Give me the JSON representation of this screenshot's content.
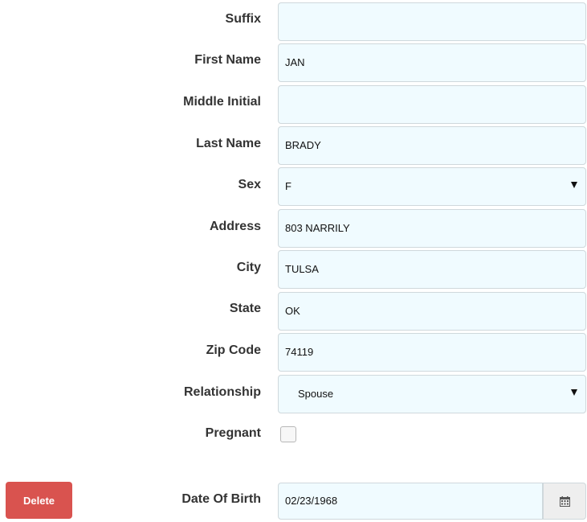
{
  "form": {
    "suffix": {
      "label": "Suffix",
      "value": ""
    },
    "first_name": {
      "label": "First Name",
      "value": "JAN"
    },
    "middle_initial": {
      "label": "Middle Initial",
      "value": ""
    },
    "last_name": {
      "label": "Last Name",
      "value": "BRADY"
    },
    "sex": {
      "label": "Sex",
      "value": "F"
    },
    "address": {
      "label": "Address",
      "value": "803 NARRILY"
    },
    "city": {
      "label": "City",
      "value": "TULSA"
    },
    "state": {
      "label": "State",
      "value": "OK"
    },
    "zip_code": {
      "label": "Zip Code",
      "value": "74119"
    },
    "relationship": {
      "label": "Relationship",
      "value": "Spouse"
    },
    "pregnant": {
      "label": "Pregnant",
      "checked": false
    },
    "date_of_birth": {
      "label": "Date Of Birth",
      "value": "02/23/1968"
    }
  },
  "actions": {
    "delete_label": "Delete"
  },
  "icons": {
    "calendar": "calendar-icon",
    "dropdown": "caret-down-icon"
  },
  "colors": {
    "field_bg": "#f0fbff",
    "field_border": "#cfd8dc",
    "delete_bg": "#d9534f",
    "label_text": "#333333"
  }
}
